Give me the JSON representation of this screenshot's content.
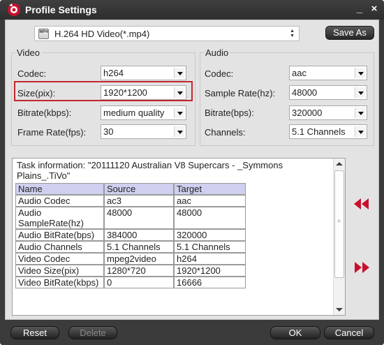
{
  "window": {
    "title": "Profile Settings",
    "minimize": "_",
    "close": "×"
  },
  "profile": {
    "format_icon_label": "MP4",
    "value": "H.264 HD Video(*.mp4)",
    "save_as": "Save As"
  },
  "video": {
    "legend": "Video",
    "codec_label": "Codec:",
    "codec_value": "h264",
    "size_label": "Size(pix):",
    "size_value": "1920*1200",
    "bitrate_label": "Bitrate(kbps):",
    "bitrate_value": "medium quality",
    "framerate_label": "Frame Rate(fps):",
    "framerate_value": "30"
  },
  "audio": {
    "legend": "Audio",
    "codec_label": "Codec:",
    "codec_value": "aac",
    "samplerate_label": "Sample Rate(hz):",
    "samplerate_value": "48000",
    "bitrate_label": "Bitrate(bps):",
    "bitrate_value": "320000",
    "channels_label": "Channels:",
    "channels_value": "5.1 Channels"
  },
  "task": {
    "line1": "Task information: \"20111120 Australian V8 Supercars - _Symmons",
    "line2": "Plains_.TiVo\"",
    "headers": [
      "Name",
      "Source",
      "Target"
    ],
    "rows": [
      [
        "Audio Codec",
        "ac3",
        "aac"
      ],
      [
        "Audio SampleRate(hz)",
        "48000",
        "48000"
      ],
      [
        "Audio BitRate(bps)",
        "384000",
        "320000"
      ],
      [
        "Audio Channels",
        "5.1 Channels",
        "5.1 Channels"
      ],
      [
        "Video Codec",
        "mpeg2video",
        "h264"
      ],
      [
        "Video Size(pix)",
        "1280*720",
        "1920*1200"
      ],
      [
        "Video BitRate(kbps)",
        "0",
        "16666"
      ]
    ]
  },
  "buttons": {
    "reset": "Reset",
    "delete": "Delete",
    "ok": "OK",
    "cancel": "Cancel"
  },
  "colors": {
    "accent_red": "#c0272d",
    "nav_arrow_red": "#c8102e",
    "header_bg": "#cfcfef"
  }
}
